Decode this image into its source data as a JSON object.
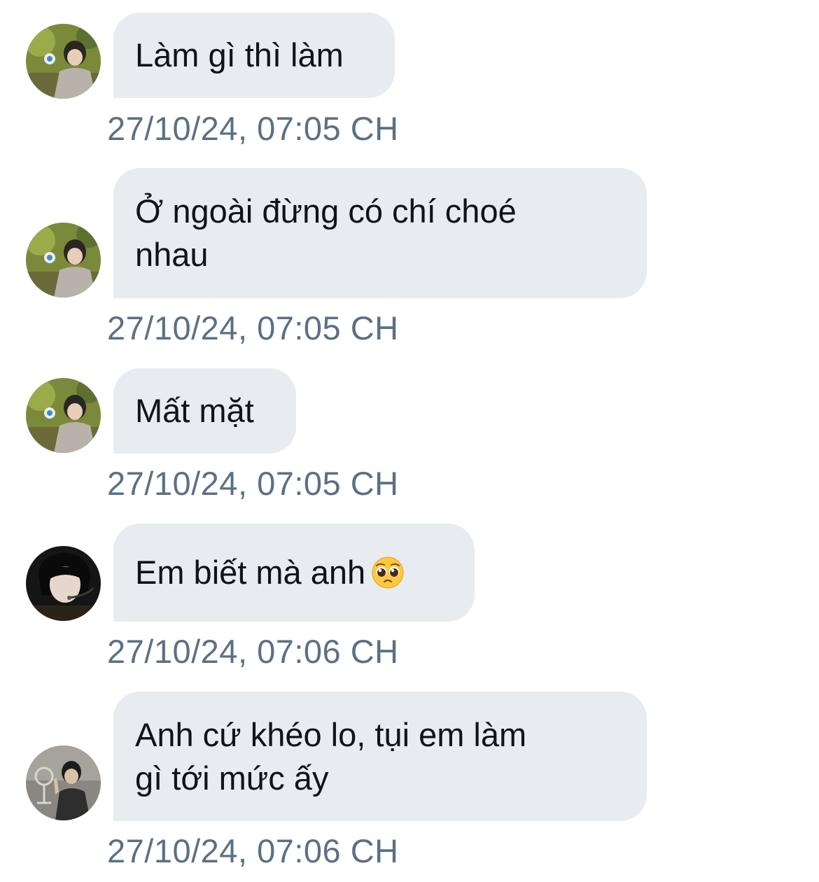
{
  "messages": [
    {
      "avatar": "avatar-user-a",
      "text": "Làm gì thì làm",
      "timestamp": "27/10/24, 07:05 CH"
    },
    {
      "avatar": "avatar-user-a",
      "text": "Ở ngoài đừng có chí choé\nnhau",
      "timestamp": "27/10/24, 07:05 CH"
    },
    {
      "avatar": "avatar-user-a",
      "text": "Mất mặt",
      "timestamp": "27/10/24, 07:05 CH"
    },
    {
      "avatar": "avatar-user-b",
      "text": "Em biết mà anh",
      "emoji": "pleading-face-emoji",
      "timestamp": "27/10/24, 07:06 CH"
    },
    {
      "avatar": "avatar-user-c",
      "text": "Anh cứ khéo lo, tụi em làm\ngì tới mức ấy",
      "timestamp": "27/10/24, 07:06 CH"
    }
  ],
  "colors": {
    "bubble_bg": "#e8ecf0",
    "message_text": "#0f1419",
    "timestamp_text": "#5b7083"
  }
}
